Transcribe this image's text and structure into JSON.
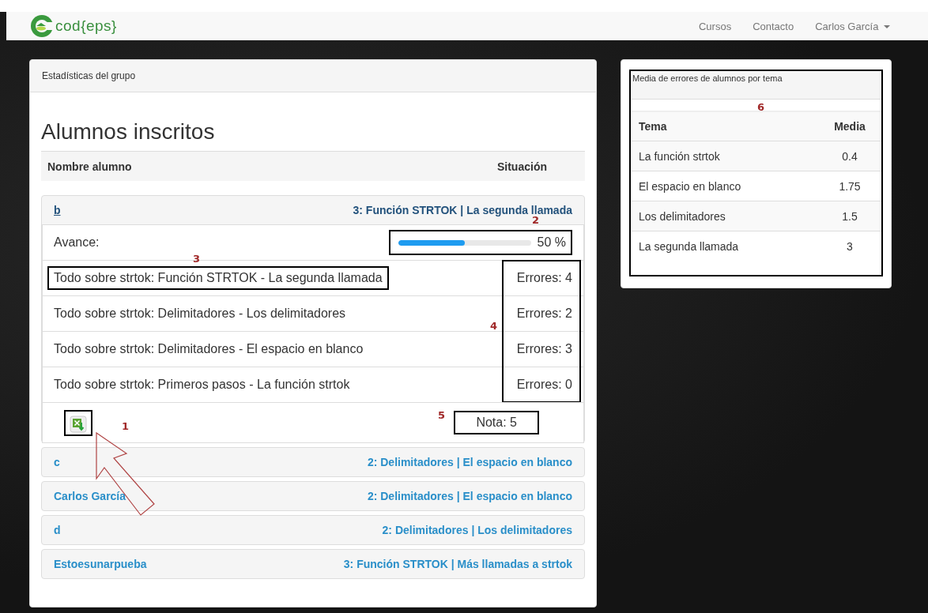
{
  "nav": {
    "logo": "cod{eps}",
    "links": [
      "Cursos",
      "Contacto"
    ],
    "user": "Carlos García"
  },
  "group_panel": {
    "title": "Estadísticas del grupo",
    "heading": "Alumnos inscritos",
    "columns": [
      "Nombre alumno",
      "Situación"
    ],
    "students": [
      {
        "name": "b",
        "situation": "3: Función STRTOK | La segunda llamada",
        "expanded": true,
        "progress_label": "Avance:",
        "level": 0.5,
        "reading": "50 %",
        "progress_callout": "2",
        "errors_callout": "4",
        "topics": [
          {
            "name": "Todo sobre strtok: Función STRTOK - La segunda llamada",
            "errors": "Errores: 4",
            "callout": "3"
          },
          {
            "name": "Todo sobre strtok: Delimitadores - Los delimitadores",
            "errors": "Errores: 2"
          },
          {
            "name": "Todo sobre strtok: Delimitadores - El espacio en blanco",
            "errors": "Errores: 3"
          },
          {
            "name": "Todo sobre strtok: Primeros pasos - La función strtok",
            "errors": "Errores: 0"
          }
        ],
        "export_callout": "1",
        "grade": "Nota: 5",
        "grade_callout": "5"
      },
      {
        "name": "c",
        "situation": "2: Delimitadores | El espacio en blanco",
        "expanded": false
      },
      {
        "name": "Carlos García",
        "situation": "2: Delimitadores | El espacio en blanco",
        "expanded": false
      },
      {
        "name": "d",
        "situation": "2: Delimitadores | Los delimitadores",
        "expanded": false
      },
      {
        "name": "Estoesunarpueba",
        "situation": "3: Función STRTOK | Más llamadas a strtok",
        "expanded": false
      }
    ]
  },
  "averages_panel": {
    "title": "Media de errores de alumnos por tema",
    "callout": "6",
    "columns": [
      "Tema",
      "Media"
    ],
    "rows": [
      {
        "topic": "La función strtok",
        "average": "0.4"
      },
      {
        "topic": "El espacio en blanco",
        "average": "1.75"
      },
      {
        "topic": "Los delimitadores",
        "average": "1.5"
      },
      {
        "topic": "La segunda llamada",
        "average": "3"
      }
    ]
  }
}
